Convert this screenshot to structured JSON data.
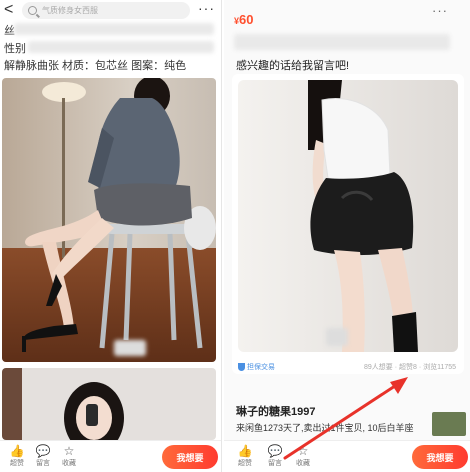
{
  "left": {
    "search_placeholder": "气质修身女西服",
    "more_glyph": "···",
    "back_glyph": "<",
    "desc_lines": [
      "丝",
      "性别",
      "解静脉曲张 材质：包芯丝 图案：纯色"
    ],
    "bottom_nav": [
      {
        "icon": "like-icon",
        "glyph": "👍",
        "label": "超赞"
      },
      {
        "icon": "comment-icon",
        "glyph": "💬",
        "label": "留言"
      },
      {
        "icon": "star-icon",
        "glyph": "☆",
        "label": "收藏"
      }
    ],
    "want_button": "我想要"
  },
  "right": {
    "price_currency": "¥",
    "price_value": "60",
    "more_glyph": "···",
    "desc_text": "感兴趣的话给我留言吧!",
    "guarantee_text": "担保交易",
    "stats_text": "89人想要 · 超赞8 · 浏览11755",
    "seller_name": "琳子的糖果1997",
    "seller_meta": "来闲鱼1273天了,卖出过1件宝贝, 10后白羊座",
    "bottom_nav": [
      {
        "icon": "like-icon",
        "glyph": "👍",
        "label": "超赞"
      },
      {
        "icon": "comment-icon",
        "glyph": "💬",
        "label": "留言"
      },
      {
        "icon": "star-icon",
        "glyph": "☆",
        "label": "收藏"
      }
    ],
    "want_button": "我想要"
  },
  "colors": {
    "accent": "#ff4f2e",
    "button_gradient_start": "#ff6a3a",
    "button_gradient_end": "#ff3b2f",
    "arrow": "#e8322a",
    "guarantee_blue": "#4a90e2"
  }
}
